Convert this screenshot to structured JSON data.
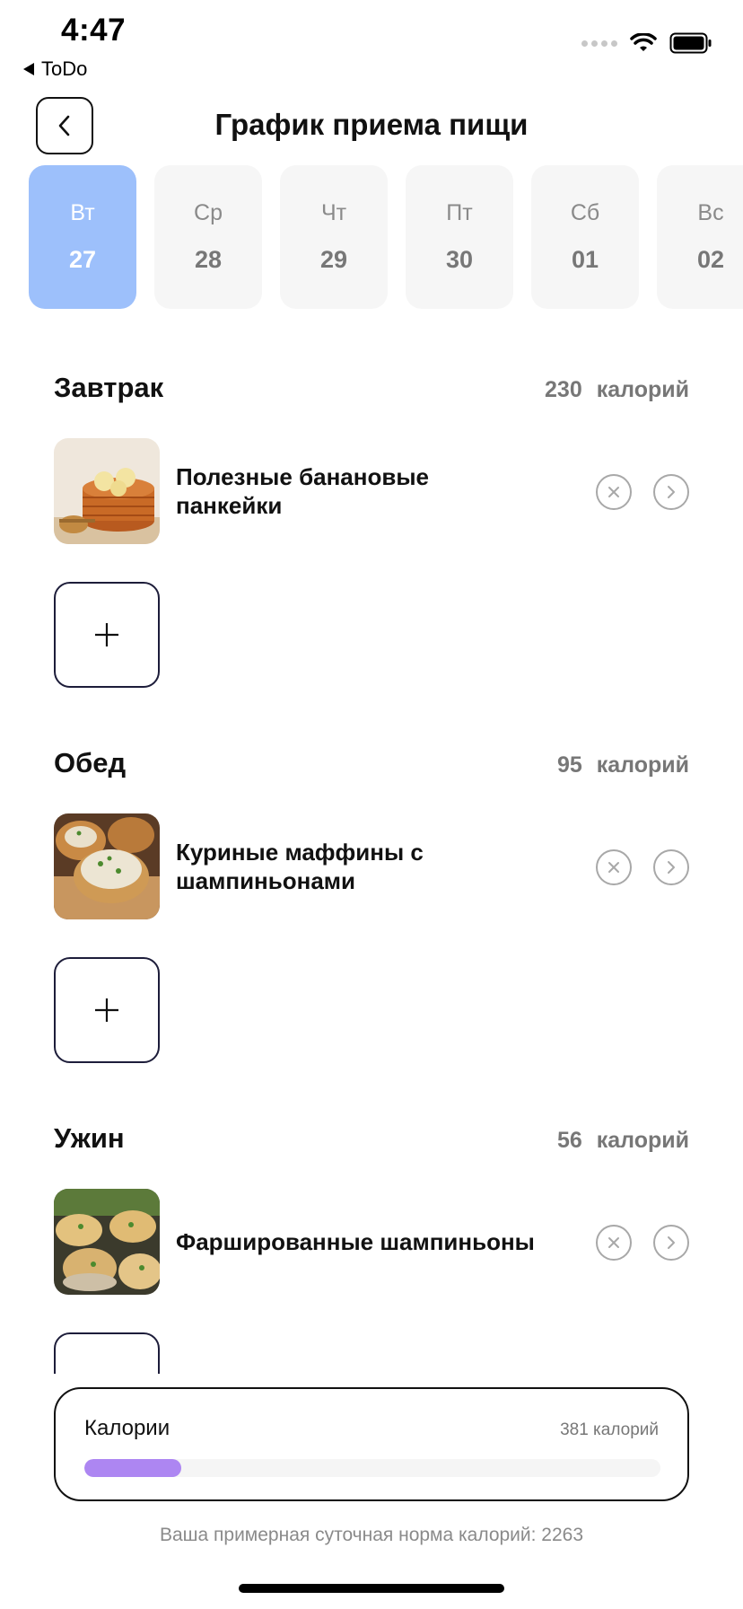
{
  "status": {
    "time": "4:47",
    "back_app": "ToDo"
  },
  "header": {
    "title": "График приема пищи"
  },
  "days": [
    {
      "name": "Вт",
      "num": "27",
      "active": true
    },
    {
      "name": "Ср",
      "num": "28",
      "active": false
    },
    {
      "name": "Чт",
      "num": "29",
      "active": false
    },
    {
      "name": "Пт",
      "num": "30",
      "active": false
    },
    {
      "name": "Сб",
      "num": "01",
      "active": false
    },
    {
      "name": "Вс",
      "num": "02",
      "active": false
    }
  ],
  "sections": [
    {
      "title": "Завтрак",
      "calories": "230",
      "unit": "калорий",
      "meal": "Полезные банановые панкейки",
      "meal_line1": "Полезные банановые",
      "meal_line2": "панкейки"
    },
    {
      "title": "Обед",
      "calories": "95",
      "unit": "калорий",
      "meal": "Куриные маффины с шампиньонами",
      "meal_line1": "Куриные маффины с",
      "meal_line2": "шампиньонами"
    },
    {
      "title": "Ужин",
      "calories": "56",
      "unit": "калорий",
      "meal": "Фаршированные шампиньоны",
      "meal_line1": "Фаршированные шампиньоны",
      "meal_line2": ""
    }
  ],
  "calorie_card": {
    "label": "Калории",
    "total": "381 калорий",
    "progress": 0.168
  },
  "footer": {
    "norm": "Ваша примерная суточная норма калорий: 2263"
  },
  "colors": {
    "active_day": "#9dc0fb",
    "progress": "#ad86f2",
    "border_dark": "#1d1d3a"
  },
  "icons": {
    "back": "chevron-left-icon",
    "remove": "close-circle-icon",
    "open": "chevron-right-circle-icon",
    "add": "plus-icon"
  }
}
